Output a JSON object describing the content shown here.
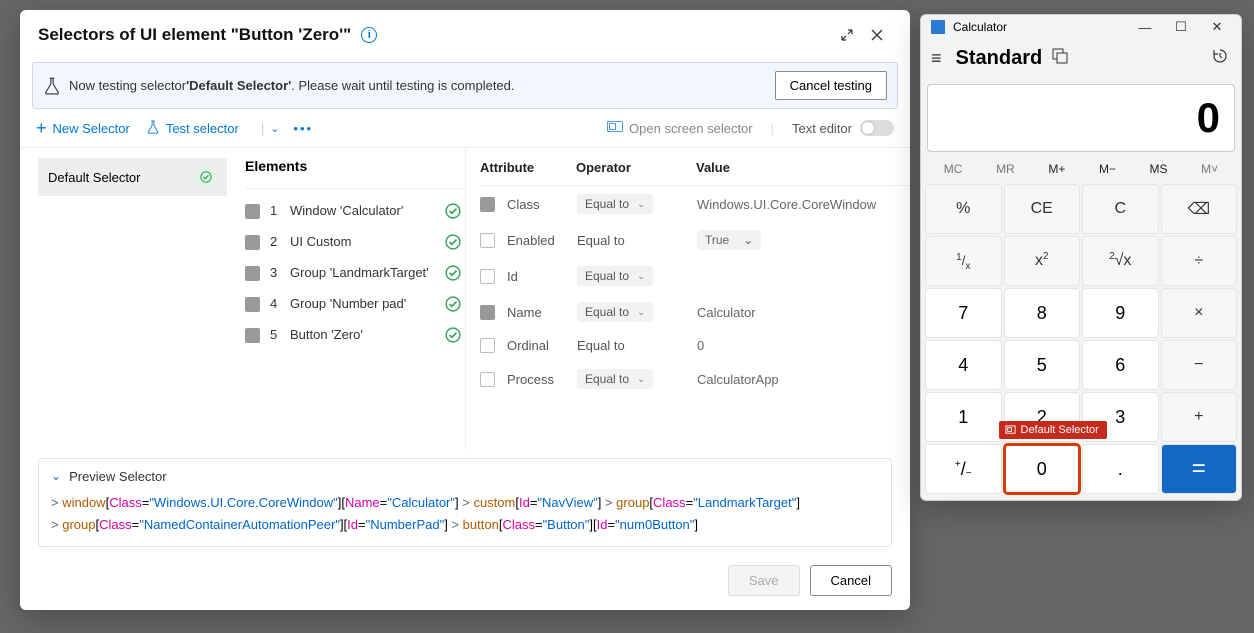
{
  "editor": {
    "title": "Selectors of UI element \"Button 'Zero'\"",
    "testing_prefix": "Now testing selector ",
    "testing_bold": "'Default Selector'",
    "testing_suffix": ". Please wait until testing is completed.",
    "cancel_testing": "Cancel testing",
    "toolbar": {
      "new_selector": "New Selector",
      "test_selector": "Test selector",
      "open_screen": "Open screen selector",
      "text_editor": "Text editor"
    },
    "selector_name": "Default Selector",
    "elements_heading": "Elements",
    "elements": [
      {
        "idx": "1",
        "label": "Window 'Calculator'"
      },
      {
        "idx": "2",
        "label": "UI Custom"
      },
      {
        "idx": "3",
        "label": "Group 'LandmarkTarget'"
      },
      {
        "idx": "4",
        "label": "Group 'Number pad'"
      },
      {
        "idx": "5",
        "label": "Button 'Zero'"
      }
    ],
    "attr_headers": {
      "a": "Attribute",
      "o": "Operator",
      "v": "Value"
    },
    "attrs": [
      {
        "checked": true,
        "name": "Class",
        "op": "Equal to",
        "opPill": true,
        "val": "Windows.UI.Core.CoreWindow"
      },
      {
        "checked": false,
        "name": "Enabled",
        "op": "Equal to",
        "opPill": false,
        "val": "True",
        "valPill": true
      },
      {
        "checked": false,
        "name": "Id",
        "op": "Equal to",
        "opPill": true,
        "val": ""
      },
      {
        "checked": true,
        "name": "Name",
        "op": "Equal to",
        "opPill": true,
        "val": "Calculator"
      },
      {
        "checked": false,
        "name": "Ordinal",
        "op": "Equal to",
        "opPill": false,
        "val": "0"
      },
      {
        "checked": false,
        "name": "Process",
        "op": "Equal to",
        "opPill": true,
        "val": "CalculatorApp"
      }
    ],
    "preview_label": "Preview Selector",
    "save": "Save",
    "cancel": "Cancel"
  },
  "preview_tokens": [
    [
      ">",
      " ",
      "tag:window",
      "[",
      "attr:Class",
      "=",
      "val:\"Windows.UI.Core.CoreWindow\"",
      "][",
      "attr:Name",
      "=",
      "val:\"Calculator\"",
      "] ",
      ">",
      " ",
      "tag:custom",
      "[",
      "attr:Id",
      "=",
      "val:\"NavView\"",
      "] ",
      ">",
      " ",
      "tag:group",
      "[",
      "attr:Class",
      "=",
      "val:\"LandmarkTarget\"",
      "]"
    ],
    [
      ">",
      " ",
      "tag:group",
      "[",
      "attr:Class",
      "=",
      "val:\"NamedContainerAutomationPeer\"",
      "][",
      "attr:Id",
      "=",
      "val:\"NumberPad\"",
      "] ",
      ">",
      " ",
      "tag:button",
      "[",
      "attr:Class",
      "=",
      "val:\"Button\"",
      "][",
      "attr:Id",
      "=",
      "val:\"num0Button\"",
      "]"
    ]
  ],
  "calc": {
    "title": "Calculator",
    "mode": "Standard",
    "display": "0",
    "mem": [
      "MC",
      "MR",
      "M+",
      "M−",
      "MS",
      "M˅"
    ],
    "mem_active": [
      false,
      false,
      true,
      true,
      true,
      false
    ],
    "zero_tip": "Default Selector"
  },
  "keys": [
    {
      "t": "%",
      "c": "fn"
    },
    {
      "t": "CE",
      "c": "fn"
    },
    {
      "t": "C",
      "c": "fn"
    },
    {
      "t": "⌫",
      "c": "fn"
    },
    {
      "html": "<span class='frac'><span class='sup'>1</span>/<span class='sub'>x</span></span>",
      "c": "fn"
    },
    {
      "html": "x<span class='sup'>2</span>",
      "c": "fn"
    },
    {
      "html": "<span class='sup'>2</span>√x",
      "c": "fn"
    },
    {
      "t": "÷",
      "c": "fn"
    },
    {
      "t": "7",
      "c": "num"
    },
    {
      "t": "8",
      "c": "num"
    },
    {
      "t": "9",
      "c": "num"
    },
    {
      "t": "×",
      "c": "fn"
    },
    {
      "t": "4",
      "c": "num"
    },
    {
      "t": "5",
      "c": "num"
    },
    {
      "t": "6",
      "c": "num"
    },
    {
      "t": "−",
      "c": "fn"
    },
    {
      "t": "1",
      "c": "num"
    },
    {
      "t": "2",
      "c": "num"
    },
    {
      "t": "3",
      "c": "num"
    },
    {
      "t": "+",
      "c": "fn"
    },
    {
      "html": "<span class='sup'>+</span>/<span class='sub'>−</span>",
      "c": "num"
    },
    {
      "t": "0",
      "c": "num",
      "zero": true
    },
    {
      "t": ".",
      "c": "num"
    },
    {
      "t": "=",
      "c": "eq"
    }
  ]
}
